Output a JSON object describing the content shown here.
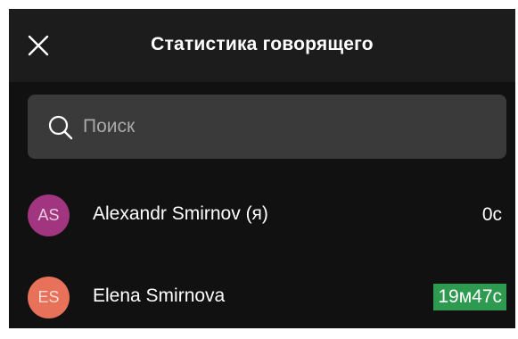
{
  "header": {
    "title": "Статистика говорящего",
    "close_icon": "close-icon"
  },
  "search": {
    "placeholder": "Поиск",
    "value": "",
    "icon": "search-icon"
  },
  "participants": [
    {
      "initials": "AS",
      "name": "Alexandr Smirnov (я)",
      "duration": "0с",
      "avatar_color": "#a1357f",
      "highlight": false
    },
    {
      "initials": "ES",
      "name": "Elena Smirnova",
      "duration": "19м47с",
      "avatar_color": "#e8715a",
      "highlight": true,
      "highlight_color": "#2e9a4f"
    }
  ],
  "colors": {
    "background": "#111111",
    "header_background": "#1c1c1c",
    "search_background": "#3a3a3a"
  }
}
